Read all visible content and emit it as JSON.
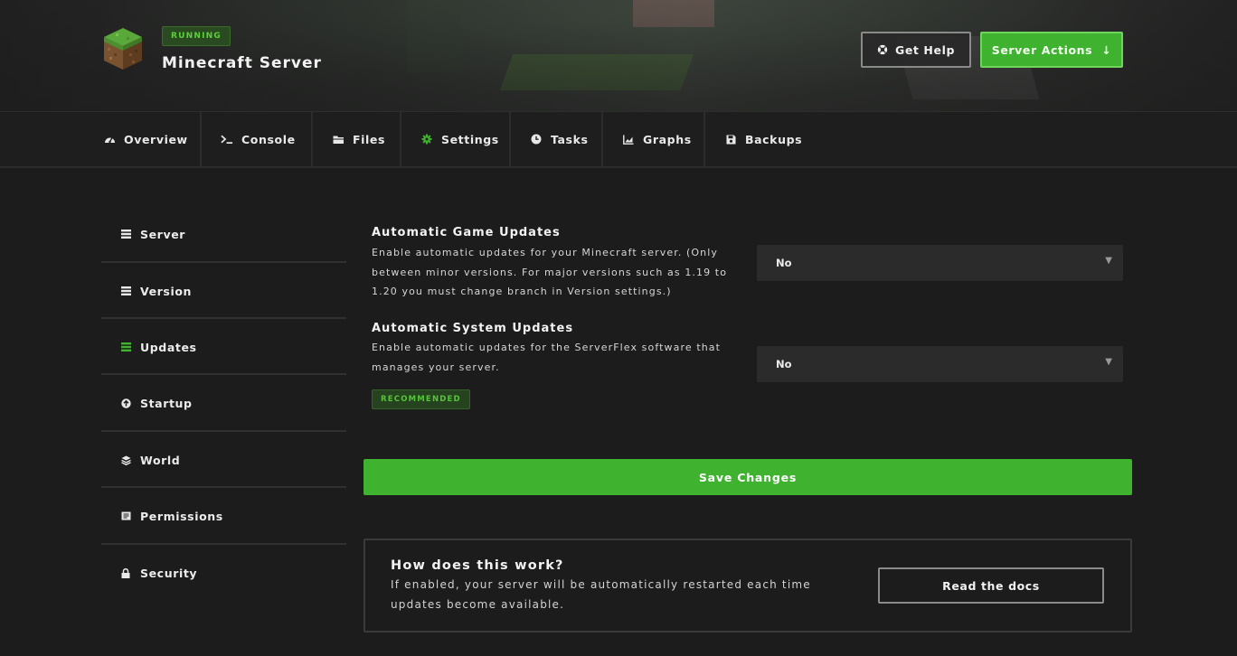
{
  "header": {
    "status": "RUNNING",
    "server_name": "Minecraft Server",
    "help_label": "Get Help",
    "actions_label": "Server Actions",
    "actions_arrow": "↓"
  },
  "tabs": [
    {
      "label": "Overview",
      "icon": "gauge-icon"
    },
    {
      "label": "Console",
      "icon": "terminal-icon"
    },
    {
      "label": "Files",
      "icon": "folder-icon"
    },
    {
      "label": "Settings",
      "icon": "gear-icon",
      "active": true
    },
    {
      "label": "Tasks",
      "icon": "clock-icon"
    },
    {
      "label": "Graphs",
      "icon": "chart-icon"
    },
    {
      "label": "Backups",
      "icon": "save-icon"
    }
  ],
  "sidebar": {
    "items": [
      {
        "label": "Server",
        "icon": "list-icon"
      },
      {
        "label": "Version",
        "icon": "list-icon"
      },
      {
        "label": "Updates",
        "icon": "list-icon",
        "active": true
      },
      {
        "label": "Startup",
        "icon": "arrow-up-circle-icon"
      },
      {
        "label": "World",
        "icon": "layers-icon"
      },
      {
        "label": "Permissions",
        "icon": "document-icon"
      },
      {
        "label": "Security",
        "icon": "lock-icon"
      }
    ]
  },
  "settings": {
    "game_updates": {
      "title": "Automatic Game Updates",
      "desc_line1": "Enable automatic updates for your Minecraft server. (Only",
      "desc_line2": "between minor versions. For major versions such as 1.19 to",
      "desc_line3": "1.20 you must change branch in Version settings.)",
      "value": "No"
    },
    "system_updates": {
      "title": "Automatic System Updates",
      "desc_line1": "Enable automatic updates for the ServerFlex software that",
      "desc_line2": "manages your server.",
      "value": "No",
      "badge": "RECOMMENDED"
    },
    "save_label": "Save Changes"
  },
  "info": {
    "title": "How does this work?",
    "line1": "If enabled, your server will be automatically restarted each time",
    "line2": "updates become available.",
    "docs_label": "Read the docs"
  },
  "colors": {
    "accent": "#3fb22f",
    "background": "#1c1c1c",
    "running": "#5bd03b"
  }
}
